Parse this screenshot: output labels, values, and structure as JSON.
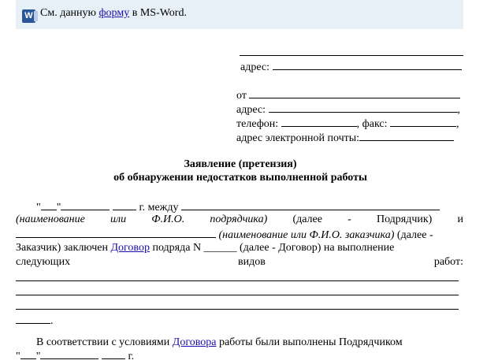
{
  "banner": {
    "icon": "word-icon",
    "text_before": "См. данную",
    "link": "форму",
    "text_after": "в MS-Word."
  },
  "header": {
    "addr1": "адрес:",
    "from": "от",
    "addr2": "адрес:",
    "phone": "телефон:",
    "fax": ", факс:",
    "email": "адрес электронной почты:"
  },
  "title": {
    "line1": "Заявление (претензия)",
    "line2": "об обнаружении недостатков выполненной работы"
  },
  "body": {
    "quote_open": "\"",
    "quote_close": "\"",
    "year_between": "г. между",
    "name_contractor": "(наименование или Ф.И.О. подрядчика)",
    "dalee_contractor": "(далее - Подрядчик) и",
    "name_customer": "(наименование или Ф.И.О. заказчика)",
    "dalee_customer": "(далее -",
    "customer_concluded": "Заказчик) заключен",
    "contract_link": "Договор",
    "contract_rest": "подряда N ______ (далее - Договор) на выполнение",
    "following": "следующих",
    "types": "видов",
    "works": "работ:",
    "accordance_pre": "В соответствии с условиями",
    "contract_link2": "Договора",
    "accordance_post": "работы были выполнены Подрядчиком",
    "year": "г."
  }
}
